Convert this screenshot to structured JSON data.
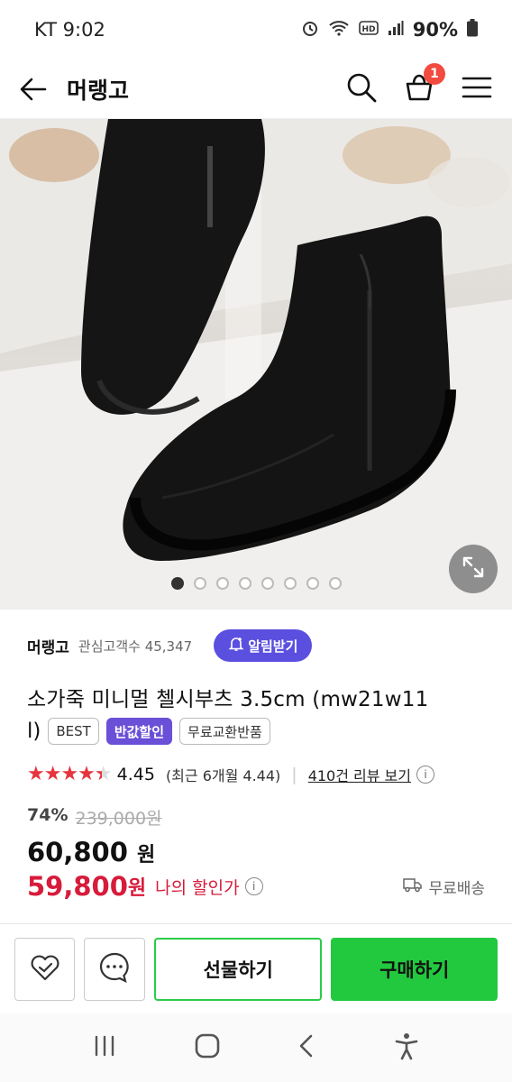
{
  "status_bar": {
    "carrier_time": "KT 9:02",
    "battery": "90%"
  },
  "app_bar": {
    "title": "머랭고",
    "cart_count": "1"
  },
  "gallery": {
    "image_count": 8,
    "active_index": 0
  },
  "product": {
    "brand": "머랭고",
    "followers_label": "관심고객수 45,347",
    "notify_label": "알림받기",
    "name_line1": "소가죽 미니멀 첼시부츠 3.5cm (mw21w11",
    "name_line2": "l)",
    "tags": [
      "BEST",
      "반값할인",
      "무료교환반품"
    ],
    "rating": "4.45",
    "recent_rating": "(최근 6개월 4.44)",
    "reviews_label": "410건 리뷰 보기",
    "discount_pct": "74%",
    "original_price": "239,000원",
    "price": "60,800",
    "price_unit": "원",
    "my_price": "59,800",
    "my_price_unit": "원",
    "my_price_label": "나의 할인가",
    "shipping": "무료배송"
  },
  "actions": {
    "gift": "선물하기",
    "buy": "구매하기"
  },
  "colors": {
    "accent_green": "#22c93f",
    "accent_purple": "#5b4fe0",
    "price_red": "#d71b3b",
    "star_red": "#e6353d"
  }
}
